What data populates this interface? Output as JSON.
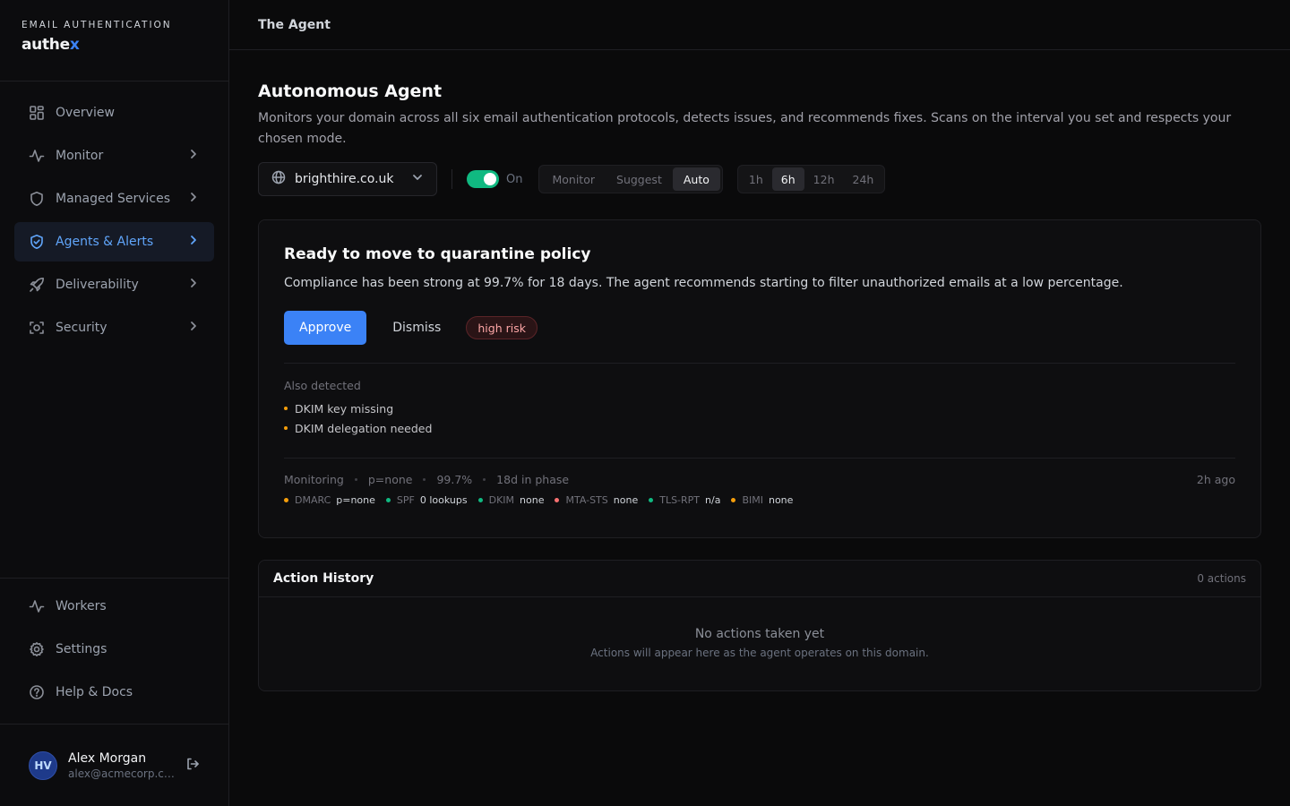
{
  "brand": {
    "subtitle": "EMAIL AUTHENTICATION",
    "name_main": "authe",
    "name_accent": "x"
  },
  "sidebar": {
    "items": [
      {
        "label": "Overview",
        "icon": "grid-icon",
        "active": false,
        "has_chevron": false
      },
      {
        "label": "Monitor",
        "icon": "activity-icon",
        "active": false,
        "has_chevron": true
      },
      {
        "label": "Managed Services",
        "icon": "shield-icon",
        "active": false,
        "has_chevron": true
      },
      {
        "label": "Agents & Alerts",
        "icon": "shield-check-icon",
        "active": true,
        "has_chevron": true
      },
      {
        "label": "Deliverability",
        "icon": "rocket-icon",
        "active": false,
        "has_chevron": true
      },
      {
        "label": "Security",
        "icon": "scan-icon",
        "active": false,
        "has_chevron": true
      }
    ],
    "bottom_items": [
      {
        "label": "Workers",
        "icon": "activity-icon"
      },
      {
        "label": "Settings",
        "icon": "gear-icon"
      },
      {
        "label": "Help & Docs",
        "icon": "help-circle-icon"
      }
    ],
    "user": {
      "initials": "HV",
      "name": "Alex Morgan",
      "email": "alex@acmecorp.com"
    }
  },
  "topbar": {
    "title": "The Agent"
  },
  "page": {
    "title": "Autonomous Agent",
    "description": "Monitors your domain across all six email authentication protocols, detects issues, and recommends fixes. Scans on the interval you set and respects your chosen mode."
  },
  "controls": {
    "domain": "brighthire.co.uk",
    "toggle_label": "On",
    "toggle_on": true,
    "modes": [
      "Monitor",
      "Suggest",
      "Auto"
    ],
    "selected_mode": "Auto",
    "intervals": [
      "1h",
      "6h",
      "12h",
      "24h"
    ],
    "selected_interval": "6h"
  },
  "recommendation": {
    "title": "Ready to move to quarantine policy",
    "description": "Compliance has been strong at 99.7% for 18 days. The agent recommends starting to filter unauthorized emails at a low percentage.",
    "approve_label": "Approve",
    "dismiss_label": "Dismiss",
    "risk_label": "high risk",
    "also_detected_title": "Also detected",
    "also_detected": [
      "DKIM key missing",
      "DKIM delegation needed"
    ],
    "status": {
      "phase": "Monitoring",
      "policy": "p=none",
      "compliance": "99.7%",
      "days": "18d in phase",
      "updated": "2h ago"
    },
    "protocols": [
      {
        "name": "DMARC",
        "value": "p=none",
        "color": "#f59e0b"
      },
      {
        "name": "SPF",
        "value": "0 lookups",
        "color": "#10b981"
      },
      {
        "name": "DKIM",
        "value": "none",
        "color": "#10b981"
      },
      {
        "name": "MTA-STS",
        "value": "none",
        "color": "#f87171"
      },
      {
        "name": "TLS-RPT",
        "value": "n/a",
        "color": "#10b981"
      },
      {
        "name": "BIMI",
        "value": "none",
        "color": "#f59e0b"
      }
    ]
  },
  "history": {
    "title": "Action History",
    "count": "0 actions",
    "empty_title": "No actions taken yet",
    "empty_sub": "Actions will appear here as the agent operates on this domain."
  },
  "colors": {
    "accent": "#3b82f6",
    "toggle_on": "#10b981",
    "risk": "#fca5a5"
  }
}
